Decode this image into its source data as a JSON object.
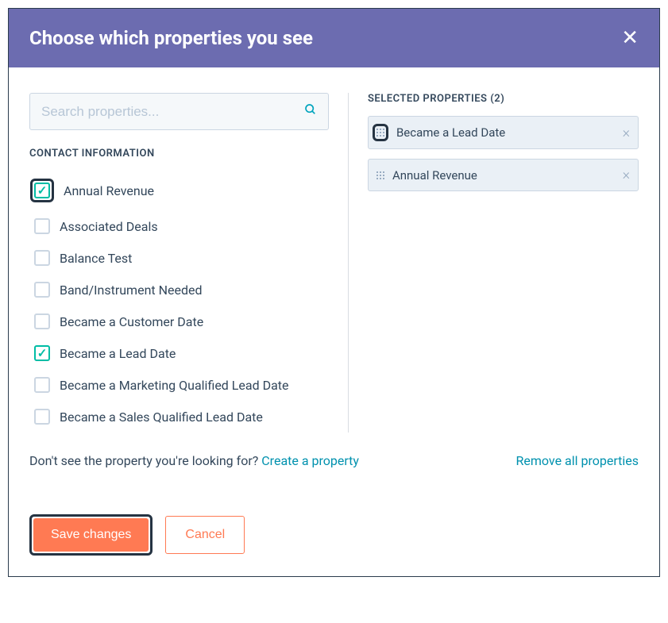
{
  "header": {
    "title": "Choose which properties you see"
  },
  "search": {
    "placeholder": "Search properties..."
  },
  "section_label": "CONTACT INFORMATION",
  "properties": [
    {
      "label": "Annual Revenue",
      "checked": true,
      "highlight": true
    },
    {
      "label": "Associated Deals",
      "checked": false,
      "highlight": false
    },
    {
      "label": "Balance Test",
      "checked": false,
      "highlight": false
    },
    {
      "label": "Band/Instrument Needed",
      "checked": false,
      "highlight": false
    },
    {
      "label": "Became a Customer Date",
      "checked": false,
      "highlight": false
    },
    {
      "label": "Became a Lead Date",
      "checked": true,
      "highlight": false
    },
    {
      "label": "Became a Marketing Qualified Lead Date",
      "checked": false,
      "highlight": false
    },
    {
      "label": "Became a Sales Qualified Lead Date",
      "checked": false,
      "highlight": false
    }
  ],
  "selected": {
    "label_prefix": "SELECTED PROPERTIES",
    "count": 2,
    "items": [
      {
        "label": "Became a Lead Date",
        "highlight_drag": true
      },
      {
        "label": "Annual Revenue",
        "highlight_drag": false
      }
    ]
  },
  "footer": {
    "missing_text": "Don't see the property you're looking for? ",
    "create_link": "Create a property",
    "remove_all": "Remove all properties",
    "save": "Save changes",
    "cancel": "Cancel"
  }
}
